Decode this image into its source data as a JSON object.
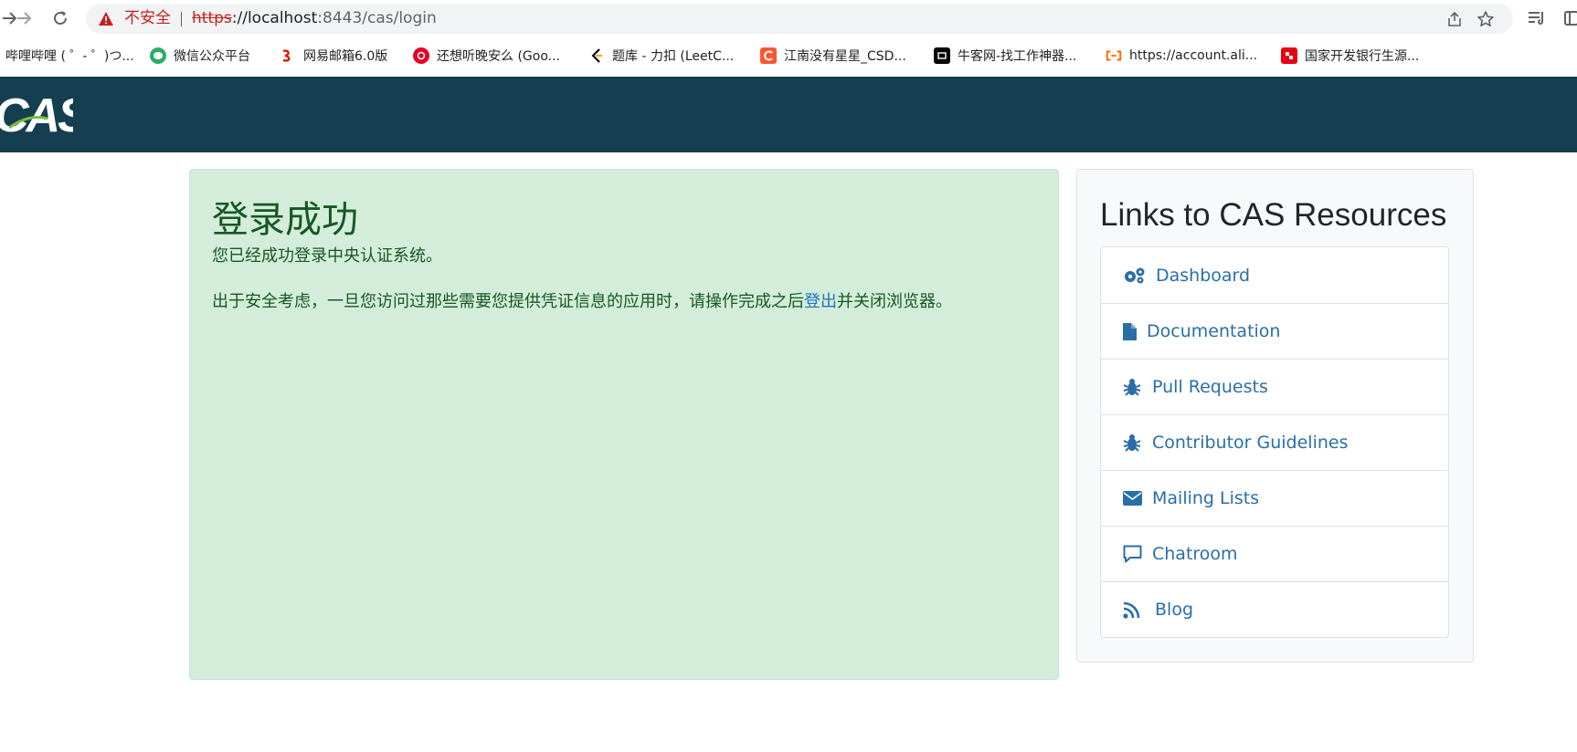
{
  "browser": {
    "security_label": "不安全",
    "url_scheme": "https",
    "url_host": "://localhost",
    "url_rest": ":8443/cas/login",
    "icons": [
      "back-icon",
      "forward-icon",
      "reload-icon",
      "warning-icon",
      "share-icon",
      "star-icon",
      "reading-list-icon",
      "side-panel-icon"
    ]
  },
  "bookmarks": [
    {
      "label": "哔哩哔哩 ( ゜- ゜)つ...",
      "icon": "bilibili-icon",
      "color": "#00a1d6"
    },
    {
      "label": "微信公众平台",
      "icon": "wechat-icon",
      "color": "#2aae67"
    },
    {
      "label": "网易邮箱6.0版",
      "icon": "netease-mail-icon",
      "color": "#d81e06"
    },
    {
      "label": "还想听晚安么 (Goo...",
      "icon": "netease-music-icon",
      "color": "#e60026"
    },
    {
      "label": "题库 - 力扣 (LeetC...",
      "icon": "leetcode-icon",
      "color": "#ffa116"
    },
    {
      "label": "江南没有星星_CSD...",
      "icon": "csdn-icon",
      "color": "#fc5531"
    },
    {
      "label": "牛客网-找工作神器...",
      "icon": "nowcoder-icon",
      "color": "#000000"
    },
    {
      "label": "https://account.ali...",
      "icon": "aliyun-icon",
      "color": "#ff6a00"
    },
    {
      "label": "国家开发银行生源...",
      "icon": "cdb-icon",
      "color": "#e60012"
    }
  ],
  "header": {
    "logo_alt": "CAS",
    "bg_color": "#153f51"
  },
  "success": {
    "title": "登录成功",
    "message": "您已经成功登录中央认证系统。",
    "security_prefix": "出于安全考虑，一旦您访问过那些需要您提供凭证信息的应用时，请操作完成之后",
    "logout_link": "登出",
    "security_suffix": "并关闭浏览器。"
  },
  "resources": {
    "title": "Links to CAS Resources",
    "items": [
      {
        "label": "Dashboard",
        "icon": "gears-icon"
      },
      {
        "label": "Documentation",
        "icon": "file-icon"
      },
      {
        "label": "Pull Requests",
        "icon": "bug-icon"
      },
      {
        "label": "Contributor Guidelines",
        "icon": "bug-icon"
      },
      {
        "label": "Mailing Lists",
        "icon": "envelope-icon"
      },
      {
        "label": "Chatroom",
        "icon": "comment-icon"
      },
      {
        "label": "Blog",
        "icon": "rss-icon"
      }
    ]
  }
}
